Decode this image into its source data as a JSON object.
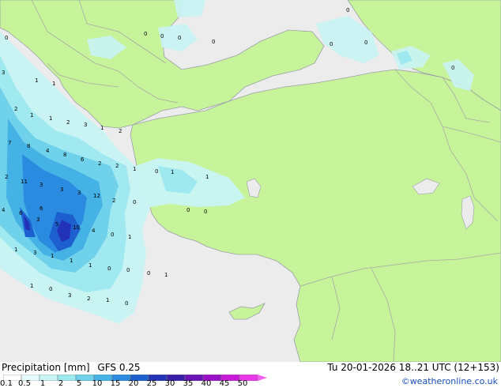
{
  "map": {
    "colors": {
      "sea": "#ececec",
      "land": "#c7f39a",
      "coast": "#9aa0a6",
      "border": "#a9a9a9"
    },
    "labels": [
      "0",
      "0",
      "0",
      "0",
      "0",
      "0",
      "0",
      "0",
      "0",
      "3",
      "1",
      "1",
      "2",
      "1",
      "1",
      "2",
      "3",
      "1",
      "2",
      "7",
      "8",
      "4",
      "8",
      "6",
      "2",
      "2",
      "1",
      "0",
      "1",
      "2",
      "11",
      "3",
      "3",
      "12",
      "3",
      "2",
      "0",
      "0",
      "0",
      "1",
      "4",
      "6",
      "6",
      "3",
      "5",
      "10",
      "4",
      "0",
      "1",
      "1",
      "3",
      "1",
      "1",
      "1",
      "0",
      "0",
      "0",
      "1",
      "1",
      "0",
      "3",
      "2",
      "1",
      "0"
    ]
  },
  "footer": {
    "title": "Precipitation [mm]",
    "model": "GFS 0.25",
    "datetime": "Tu 20-01-2026 18..21 UTC (12+153)",
    "credit": "©weatheronline.co.uk",
    "scale": [
      {
        "label": "0.1",
        "color": "#ffffff"
      },
      {
        "label": "0.5",
        "color": "#e6fbfb"
      },
      {
        "label": "1",
        "color": "#c8f4f4"
      },
      {
        "label": "2",
        "color": "#9ee8f0"
      },
      {
        "label": "5",
        "color": "#6fd2ea"
      },
      {
        "label": "10",
        "color": "#45b2e6"
      },
      {
        "label": "15",
        "color": "#2a8be0"
      },
      {
        "label": "20",
        "color": "#1e5fd0"
      },
      {
        "label": "25",
        "color": "#2233b8"
      },
      {
        "label": "30",
        "color": "#3a1ea8"
      },
      {
        "label": "35",
        "color": "#6a14b8"
      },
      {
        "label": "40",
        "color": "#9a10c8"
      },
      {
        "label": "45",
        "color": "#c818d8"
      },
      {
        "label": "50",
        "color": "#e838e8"
      }
    ]
  }
}
